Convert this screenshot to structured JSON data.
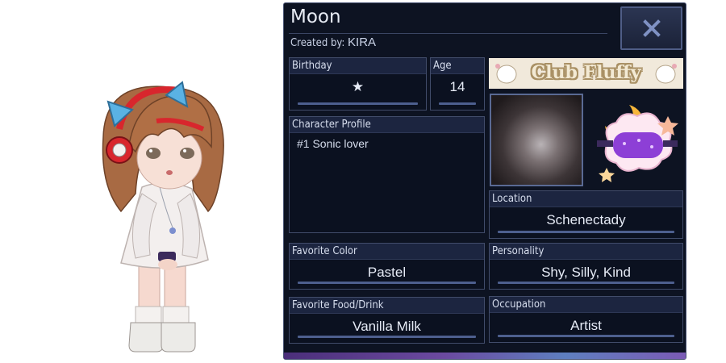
{
  "profile": {
    "name": "Moon",
    "created_by_label": "Created by:",
    "creator": "KIRA"
  },
  "close_button": {
    "label": "X"
  },
  "fields": {
    "birthday": {
      "label": "Birthday",
      "value": "★"
    },
    "age": {
      "label": "Age",
      "value": "14"
    },
    "character_profile": {
      "label": "Character Profile",
      "value": "#1 Sonic lover"
    },
    "location": {
      "label": "Location",
      "value": "Schenectady"
    },
    "favorite_color": {
      "label": "Favorite Color",
      "value": "Pastel"
    },
    "personality": {
      "label": "Personality",
      "value": "Shy, Silly, Kind"
    },
    "favorite_food_drink": {
      "label": "Favorite Food/Drink",
      "value": "Vanilla Milk"
    },
    "occupation": {
      "label": "Occupation",
      "value": "Artist"
    }
  },
  "banner": {
    "text": "Club Fluffy"
  },
  "icons": {
    "close": "close-x-icon",
    "sticker": "sleep-mask-cloud-sticker",
    "character": "gacha-character-sprite"
  },
  "colors": {
    "panel_bg": "#0d1322",
    "label_bg": "#1c2540",
    "border": "#414c6a",
    "accent_underline": "#4d5f8e",
    "close_x": "#7f91c3",
    "sticker_mask": "#8d3fd6",
    "moon_yellow": "#f6b63a"
  }
}
